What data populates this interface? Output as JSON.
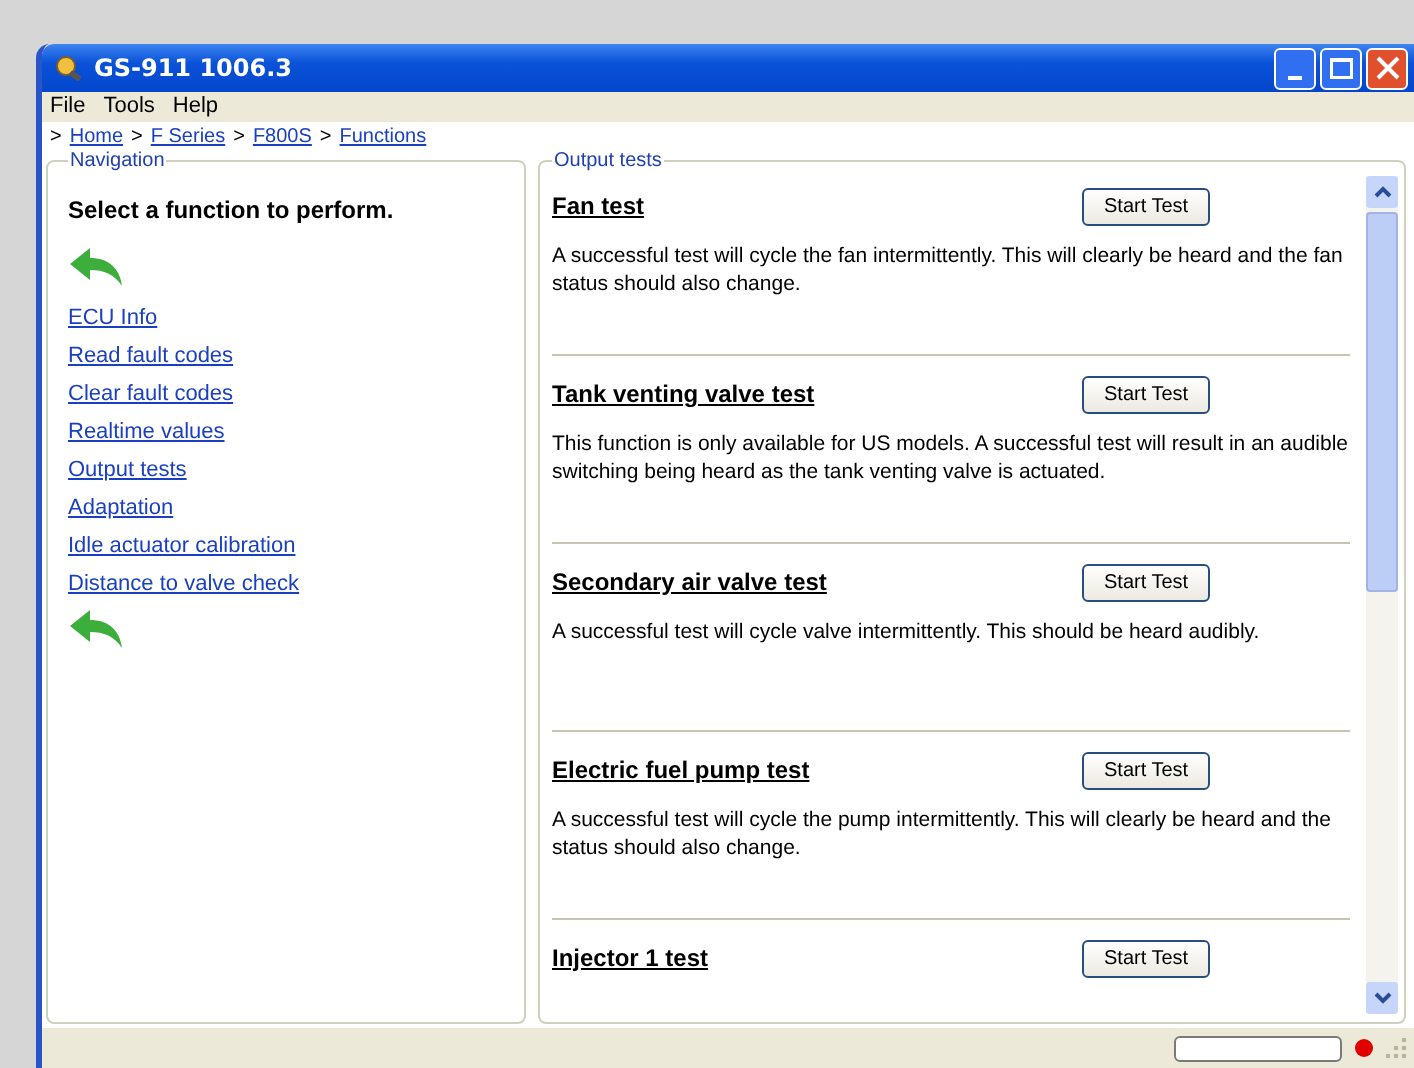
{
  "window": {
    "title": "GS-911 1006.3"
  },
  "menu": [
    "File",
    "Tools",
    "Help"
  ],
  "breadcrumb": [
    {
      "separator": ">",
      "label": "Home"
    },
    {
      "separator": ">",
      "label": "F Series"
    },
    {
      "separator": ">",
      "label": "F800S"
    },
    {
      "separator": ">",
      "label": "Functions"
    }
  ],
  "navigation": {
    "legend": "Navigation",
    "heading": "Select a function to perform.",
    "links": [
      "ECU Info",
      "Read fault codes",
      "Clear fault codes",
      "Realtime values",
      "Output tests",
      "Adaptation",
      "Idle actuator calibration",
      "Distance to valve check"
    ]
  },
  "output_tests": {
    "legend": "Output tests",
    "tests": [
      {
        "title": "Fan test",
        "button": "Start Test",
        "description": "A successful test will cycle the fan intermittently. This will clearly be heard and the fan status should also change."
      },
      {
        "title": "Tank venting valve test",
        "button": "Start Test",
        "description": "This function is only available for US models. A successful test will result in an audible switching being heard as the tank venting valve is actuated."
      },
      {
        "title": "Secondary air valve test",
        "button": "Start Test",
        "description": "A successful test will cycle valve intermittently. This should be heard audibly."
      },
      {
        "title": "Electric fuel pump test",
        "button": "Start Test",
        "description": "A successful test will cycle the pump intermittently. This will clearly be heard and the status should also change."
      },
      {
        "title": "Injector 1 test",
        "button": "Start Test"
      }
    ]
  }
}
